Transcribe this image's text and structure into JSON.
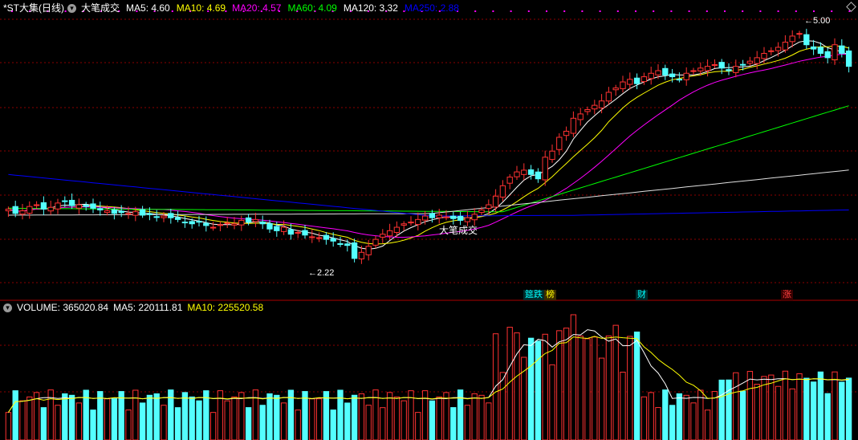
{
  "header": {
    "title": "*ST大集(日线)",
    "indicator_name": "大笔成交",
    "items": [
      {
        "label": "MA5: 4.60",
        "color": "#ffffff"
      },
      {
        "label": "MA10: 4.69",
        "color": "#ffff00"
      },
      {
        "label": "MA20: 4.57",
        "color": "#ff00ff"
      },
      {
        "label": "MA60: 4.09",
        "color": "#00ff00"
      },
      {
        "label": "MA120: 3.32",
        "color": "#ffffff"
      },
      {
        "label": "MA250: 2.88",
        "color": "#0000ff"
      }
    ]
  },
  "volume_header": {
    "title": "VOLUME: 365020.84",
    "ma5": "MA5: 220111.81",
    "ma10": "MA10: 225520.58"
  },
  "annotations": {
    "high_label": "5.00",
    "low_label": "2.22",
    "big_trade_label": "大笔成交",
    "events": [
      {
        "text": "筵跌",
        "color": "#00ffff"
      },
      {
        "text": "榜",
        "color": "#ffff00"
      },
      {
        "text": "财",
        "color": "#00ffff"
      },
      {
        "text": "涨",
        "color": "#ff4040"
      }
    ]
  },
  "colors": {
    "up": "#ff3232",
    "down": "#54ffff",
    "grid": "#8b0000",
    "ma250": "#0000ff"
  },
  "chart_data": {
    "type": "candlestick",
    "price_ylim": [
      2.1,
      5.2
    ],
    "high": 5.0,
    "low": 2.22,
    "volume_series": [
      {
        "name": "VOLUME",
        "last": 365020.84
      },
      {
        "name": "MA5",
        "last": 220111.81
      },
      {
        "name": "MA10",
        "last": 225520.58
      }
    ],
    "ma_last": {
      "MA5": 4.6,
      "MA10": 4.69,
      "MA20": 4.57,
      "MA60": 4.09,
      "MA120": 3.32,
      "MA250": 2.88
    },
    "closes": [
      2.95,
      2.9,
      2.93,
      2.98,
      3.0,
      2.95,
      2.97,
      3.02,
      3.04,
      2.99,
      3.0,
      2.98,
      2.96,
      2.94,
      2.93,
      2.9,
      2.91,
      2.9,
      2.92,
      2.88,
      2.89,
      2.86,
      2.87,
      2.85,
      2.83,
      2.8,
      2.78,
      2.8,
      2.76,
      2.74,
      2.77,
      2.79,
      2.78,
      2.82,
      2.8,
      2.83,
      2.78,
      2.72,
      2.7,
      2.74,
      2.66,
      2.68,
      2.65,
      2.63,
      2.62,
      2.6,
      2.58,
      2.55,
      2.53,
      2.38,
      2.45,
      2.52,
      2.6,
      2.66,
      2.7,
      2.74,
      2.78,
      2.8,
      2.83,
      2.87,
      2.85,
      2.88,
      2.86,
      2.84,
      2.82,
      2.85,
      2.89,
      2.94,
      3.0,
      3.1,
      3.22,
      3.32,
      3.38,
      3.4,
      3.35,
      3.3,
      3.55,
      3.62,
      3.78,
      3.85,
      4.0,
      4.05,
      4.1,
      4.15,
      4.2,
      4.3,
      4.35,
      4.42,
      4.45,
      4.4,
      4.48,
      4.52,
      4.55,
      4.5,
      4.48,
      4.45,
      4.52,
      4.55,
      4.58,
      4.6,
      4.62,
      4.58,
      4.55,
      4.6,
      4.62,
      4.66,
      4.7,
      4.75,
      4.78,
      4.82,
      4.88,
      4.95,
      4.98,
      4.85,
      4.8,
      4.75,
      4.7,
      4.85,
      4.75,
      4.6
    ]
  }
}
